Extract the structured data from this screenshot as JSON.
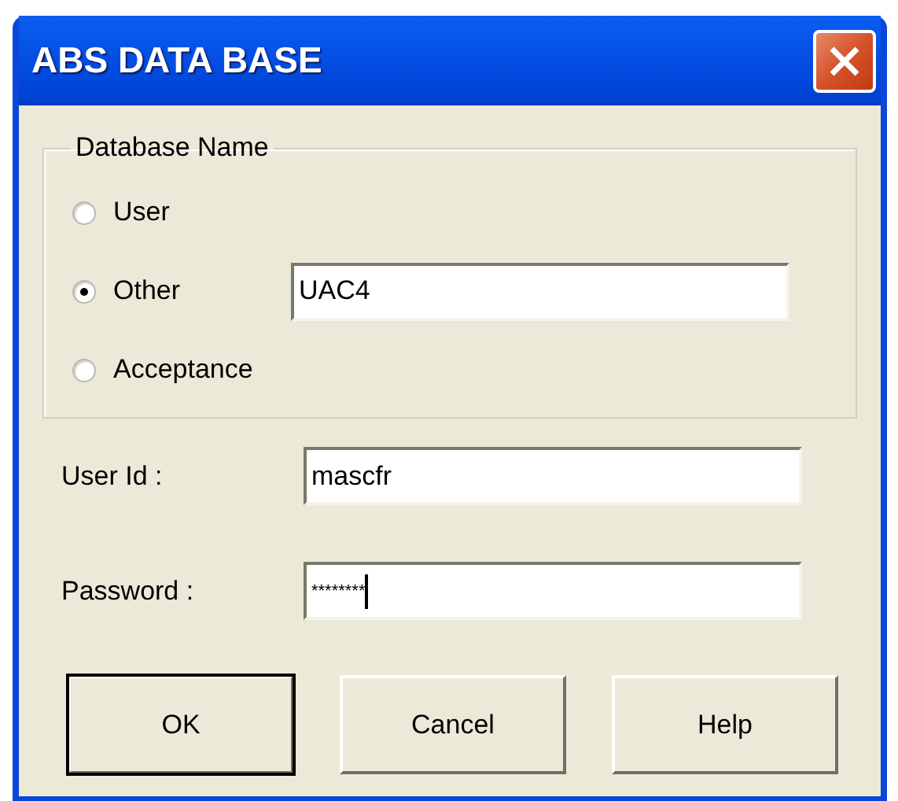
{
  "window": {
    "title": "ABS DATA BASE"
  },
  "database_group": {
    "legend": "Database Name",
    "options": [
      {
        "label": "User",
        "selected": false
      },
      {
        "label": "Other",
        "selected": true,
        "value": "UAC4"
      },
      {
        "label": "Acceptance",
        "selected": false
      }
    ]
  },
  "fields": [
    {
      "label": "User Id :",
      "value": "mascfr"
    },
    {
      "label": "Password :",
      "value": "********",
      "focused": true
    }
  ],
  "buttons": [
    {
      "label": "OK",
      "default": true
    },
    {
      "label": "Cancel",
      "default": false
    },
    {
      "label": "Help",
      "default": false
    }
  ]
}
